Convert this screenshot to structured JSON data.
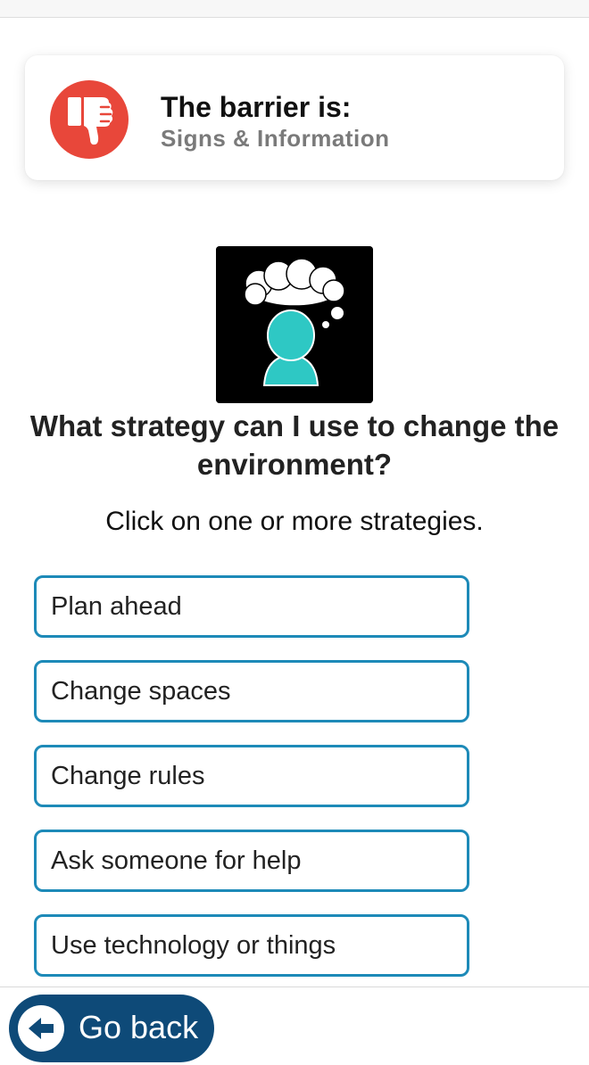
{
  "barrier": {
    "title": "The barrier is:",
    "subtitle": "Signs & Information",
    "icon": "thumbs-down-icon",
    "icon_color": "#e8473a"
  },
  "illustration": {
    "icon": "thinking-person-icon",
    "head_color": "#2ec8c4"
  },
  "question": "What strategy can I use to change the environment?",
  "instruction": "Click on one or more strategies.",
  "options": [
    {
      "label": "Plan ahead"
    },
    {
      "label": "Change spaces"
    },
    {
      "label": "Change rules"
    },
    {
      "label": "Ask someone for help"
    },
    {
      "label": "Use technology or things"
    }
  ],
  "accent_color": "#1d8ab8",
  "footer": {
    "back_label": "Go back",
    "back_icon": "arrow-left-circle-icon",
    "back_color": "#0e4a78"
  }
}
